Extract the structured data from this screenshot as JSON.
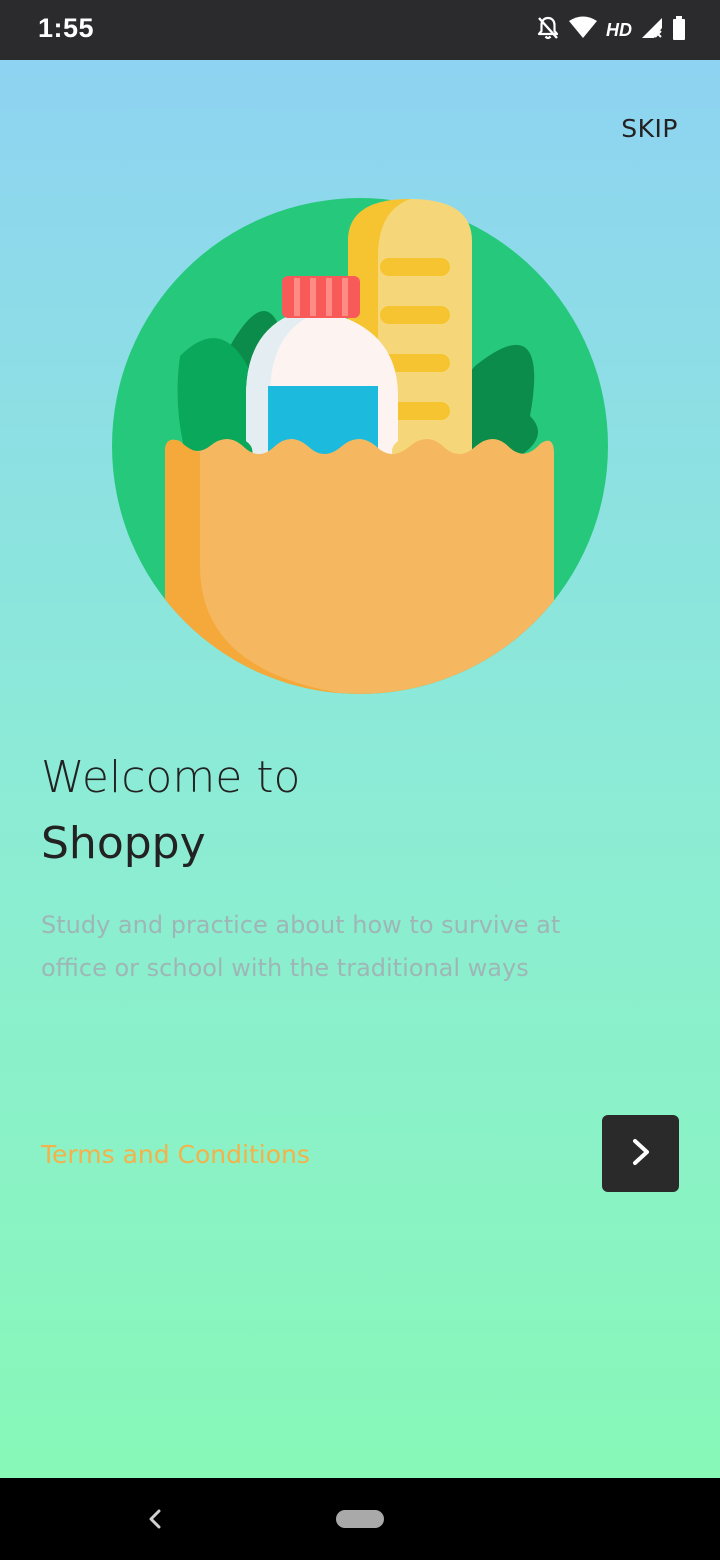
{
  "status_bar": {
    "time": "1:55",
    "hd_label": "HD",
    "icons": [
      "bell-off-icon",
      "wifi-icon",
      "signal-icon",
      "battery-icon"
    ]
  },
  "onboarding": {
    "skip_label": "SKIP",
    "welcome_text": "Welcome to",
    "brand_name": "Shoppy",
    "description": "Study and practice about how to survive at office or school with the traditional ways",
    "terms_label": "Terms and Conditions",
    "next_icon": "chevron-right-icon",
    "illustration": "grocery-bag-illustration"
  },
  "nav_bar": {
    "icons": [
      "back-icon",
      "home-pill-icon"
    ]
  },
  "colors": {
    "status_bar": "#2b2b2d",
    "gradient_top": "#8ed3f2",
    "gradient_bottom": "#88f8b8",
    "text_dark": "#222222",
    "description_text": "#9fb6b6",
    "terms_accent": "#f3b24a",
    "button_bg": "#2a2a2a"
  }
}
